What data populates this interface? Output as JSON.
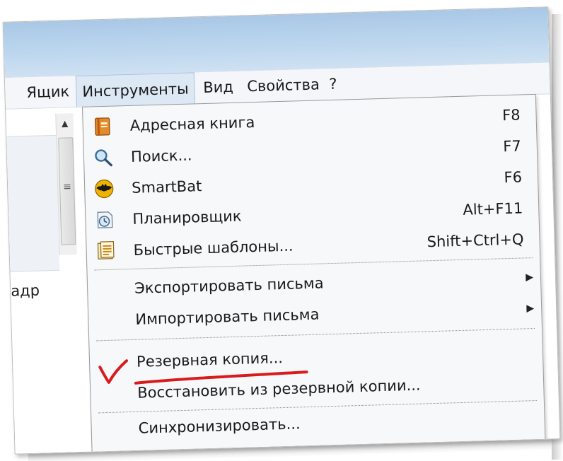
{
  "menubar": {
    "items": [
      {
        "label": "Ящик"
      },
      {
        "label": "Инструменты"
      },
      {
        "label": "Вид"
      },
      {
        "label": "Свойства"
      },
      {
        "label": "?"
      }
    ]
  },
  "leftpane": {
    "partial_label": "адр",
    "scroll_grip": "≡"
  },
  "dropdown": {
    "items": [
      {
        "label": "Адресная книга",
        "shortcut": "F8",
        "icon": "address-book-icon"
      },
      {
        "label": "Поиск...",
        "shortcut": "F7",
        "icon": "search-icon"
      },
      {
        "label": "SmartBat",
        "shortcut": "F6",
        "icon": "bat-icon"
      },
      {
        "label": "Планировщик",
        "shortcut": "Alt+F11",
        "icon": "scheduler-clock-icon"
      },
      {
        "label": "Быстрые шаблоны...",
        "shortcut": "Shift+Ctrl+Q",
        "icon": "templates-icon"
      },
      {
        "label": "Экспортировать письма",
        "submenu": "▶"
      },
      {
        "label": "Импортировать письма",
        "submenu": "▶"
      },
      {
        "label": "Резервная копия..."
      },
      {
        "label": "Восстановить из резервной копии..."
      },
      {
        "label": "Синхронизировать..."
      }
    ]
  },
  "colors": {
    "titlebar": "#bcd6ee",
    "menu_highlight": "#dde8f5",
    "annotation_red": "#d81b1b"
  }
}
